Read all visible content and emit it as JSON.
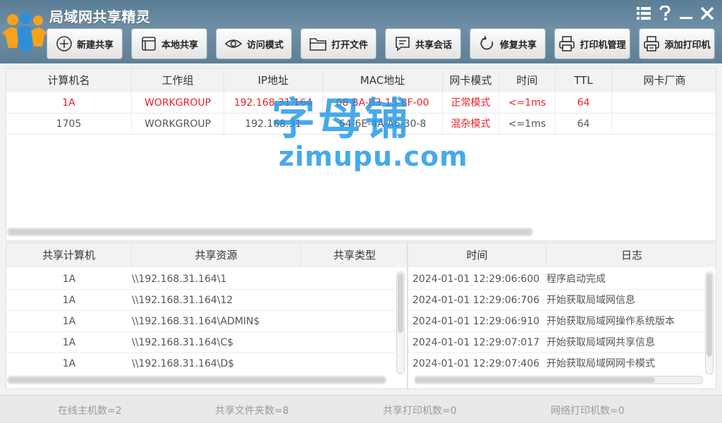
{
  "app": {
    "title": "局域网共享精灵"
  },
  "toolbar": {
    "buttons": [
      {
        "label": "新建共享",
        "icon": "plus-circle-icon"
      },
      {
        "label": "本地共享",
        "icon": "window-icon"
      },
      {
        "label": "访问模式",
        "icon": "eye-icon"
      },
      {
        "label": "打开文件",
        "icon": "folder-icon"
      },
      {
        "label": "共享会话",
        "icon": "chat-icon"
      },
      {
        "label": "修复共享",
        "icon": "refresh-icon"
      },
      {
        "label": "打印机管理",
        "icon": "printer-icon"
      },
      {
        "label": "添加打印机",
        "icon": "printer-add-icon"
      }
    ]
  },
  "hosts": {
    "columns": [
      "计算机名",
      "工作组",
      "IP地址",
      "MAC地址",
      "网卡模式",
      "时间",
      "TTL",
      "网卡厂商"
    ],
    "rows": [
      {
        "name": "1A",
        "group": "WORKGROUP",
        "ip": "192.168.31.164",
        "mac": "08-BA-B3-15-8F-00",
        "mode": "正常模式",
        "time": "<=1ms",
        "ttl": "64",
        "vendor": ""
      },
      {
        "name": "1705",
        "group": "WORKGROUP",
        "ip": "192.168.31",
        "mac": "64-6E-4A-A6-30-8",
        "mode": "混杂模式",
        "time": "<=1ms",
        "ttl": "64",
        "vendor": ""
      }
    ]
  },
  "shares": {
    "columns": [
      "共享计算机",
      "共享资源",
      "共享类型"
    ],
    "rows": [
      {
        "host": "1A",
        "resource": "\\\\192.168.31.164\\1",
        "type": ""
      },
      {
        "host": "1A",
        "resource": "\\\\192.168.31.164\\12",
        "type": ""
      },
      {
        "host": "1A",
        "resource": "\\\\192.168.31.164\\ADMIN$",
        "type": ""
      },
      {
        "host": "1A",
        "resource": "\\\\192.168.31.164\\C$",
        "type": ""
      },
      {
        "host": "1A",
        "resource": "\\\\192.168.31.164\\D$",
        "type": ""
      }
    ]
  },
  "log": {
    "columns": [
      "时间",
      "日志"
    ],
    "rows": [
      {
        "time": "2024-01-01 12:29:06:600",
        "msg": "程序启动完成"
      },
      {
        "time": "2024-01-01 12:29:06:706",
        "msg": "开始获取局域网信息"
      },
      {
        "time": "2024-01-01 12:29:06:910",
        "msg": "开始获取局域网操作系统版本"
      },
      {
        "time": "2024-01-01 12:29:07:017",
        "msg": "开始获取局域网共享信息"
      },
      {
        "time": "2024-01-01 12:29:07:406",
        "msg": "开始获取局域网网卡模式"
      }
    ]
  },
  "status": {
    "online_hosts": "在线主机数=2",
    "shared_folders": "共享文件夹数=8",
    "shared_printers": "共享打印机数=0",
    "network_printers": "网络打印机数=0"
  },
  "watermark": {
    "text": "字母铺",
    "url": "zimupu.com"
  },
  "colors": {
    "header": "#6a8ba3",
    "highlight": "#e8202a",
    "watermark": "#1e96e6"
  }
}
